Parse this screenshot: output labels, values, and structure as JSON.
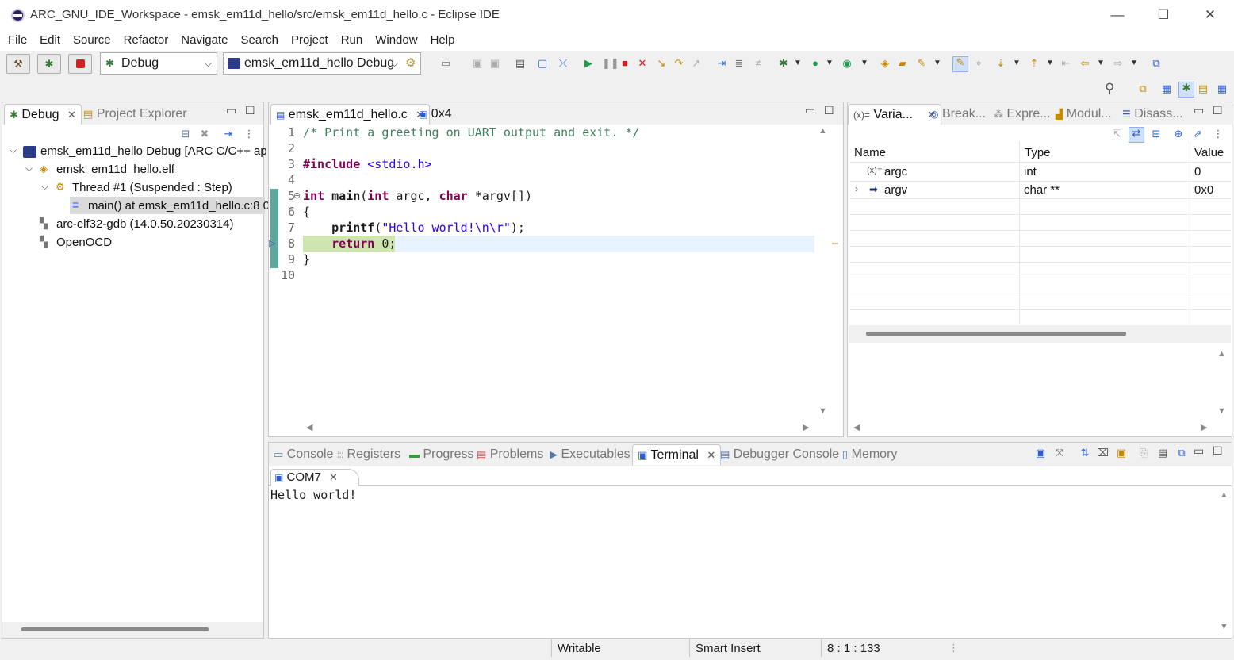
{
  "window": {
    "title": "ARC_GNU_IDE_Workspace - emsk_em11d_hello/src/emsk_em11d_hello.c - Eclipse IDE",
    "minimize": "—",
    "maximize": "☐",
    "close": "✕"
  },
  "menu": [
    "File",
    "Edit",
    "Source",
    "Refactor",
    "Navigate",
    "Search",
    "Project",
    "Run",
    "Window",
    "Help"
  ],
  "toolbar": {
    "mode": "Debug",
    "launch_config": "emsk_em11d_hello Debug"
  },
  "debug_view": {
    "tabs": [
      {
        "label": "Debug",
        "active": true
      },
      {
        "label": "Project Explorer",
        "active": false
      }
    ],
    "tree": [
      {
        "label": "emsk_em11d_hello Debug [ARC C/C++ ap",
        "level": 0
      },
      {
        "label": "emsk_em11d_hello.elf",
        "level": 1
      },
      {
        "label": "Thread #1 (Suspended : Step)",
        "level": 2
      },
      {
        "label": "main() at emsk_em11d_hello.c:8 0",
        "level": 3
      },
      {
        "label": "arc-elf32-gdb (14.0.50.20230314)",
        "level": 1
      },
      {
        "label": "OpenOCD",
        "level": 1
      }
    ]
  },
  "editor": {
    "tabs": [
      {
        "label": "emsk_em11d_hello.c",
        "active": true
      },
      {
        "label": "0x4",
        "active": false
      }
    ],
    "line_numbers": [
      "1",
      "2",
      "3",
      "4",
      "5",
      "6",
      "7",
      "8",
      "9",
      "10"
    ],
    "lines": [
      "/* Print a greeting on UART output and exit. */",
      "",
      "#include <stdio.h>",
      "",
      "int main(int argc, char *argv[])",
      "{",
      "    printf(\"Hello world!\\n\\r\");",
      "    return 0;",
      "}",
      ""
    ],
    "current_line": "8"
  },
  "variables_view": {
    "tabs": [
      "Varia...",
      "Break...",
      "Expre...",
      "Modul...",
      "Disass..."
    ],
    "columns": [
      "Name",
      "Type",
      "Value"
    ],
    "rows": [
      {
        "name": "argc",
        "type": "int",
        "value": "0"
      },
      {
        "name": "argv",
        "type": "char **",
        "value": "0x0"
      }
    ]
  },
  "bottom_view": {
    "tabs": [
      "Console",
      "Registers",
      "Progress",
      "Problems",
      "Executables",
      "Terminal",
      "Debugger Console",
      "Memory"
    ],
    "active_tab": "Terminal",
    "terminal_tab": "COM7",
    "terminal_output": "Hello world!"
  },
  "status": {
    "writable": "Writable",
    "insert_mode": "Smart Insert",
    "position": "8 : 1 : 133"
  },
  "colors": {
    "current_line_bg": "#e8f2fe",
    "step_highlight": "#cfe5b0",
    "accent": "#2a5bd7"
  }
}
